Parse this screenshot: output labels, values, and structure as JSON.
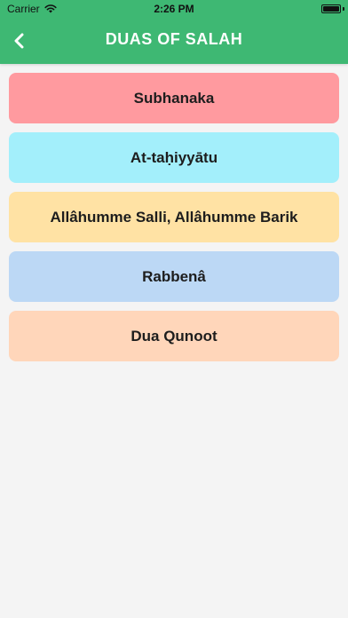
{
  "status_bar": {
    "carrier": "Carrier",
    "time": "2:26 PM"
  },
  "nav": {
    "title": "DUAS OF SALAH",
    "back_icon": "chevron-left-icon"
  },
  "colors": {
    "header": "#3eb873"
  },
  "duas": [
    {
      "label": "Subhanaka",
      "color": "#ff9a9f"
    },
    {
      "label": "At-taḥiyyātu",
      "color": "#a3effb"
    },
    {
      "label": "Allâhumme Salli, Allâhumme Barik",
      "color": "#ffe2a4"
    },
    {
      "label": "Rabbenâ",
      "color": "#bcd8f5"
    },
    {
      "label": "Dua Qunoot",
      "color": "#ffd6ba"
    }
  ]
}
